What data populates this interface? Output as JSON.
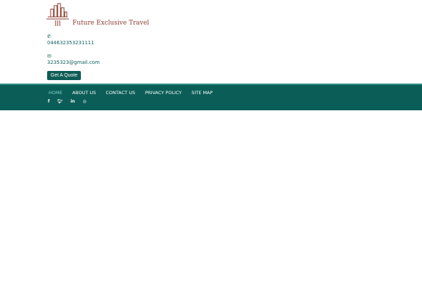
{
  "brand": {
    "name": "Future Exclusive Travel"
  },
  "contact": {
    "phone": "044632353231111",
    "email": "3235323@gmail.com"
  },
  "cta": {
    "label": "Get A Quote"
  },
  "nav": {
    "items": [
      "HOME",
      "ABOUT US",
      "CONTACT US",
      "PRIVACY POLICY",
      "SITE MAP"
    ]
  },
  "social": {
    "icons": [
      "f",
      "t",
      "in",
      "ig"
    ]
  },
  "colors": {
    "primary": "#0b5e57",
    "logo": "#8a3a2e"
  }
}
